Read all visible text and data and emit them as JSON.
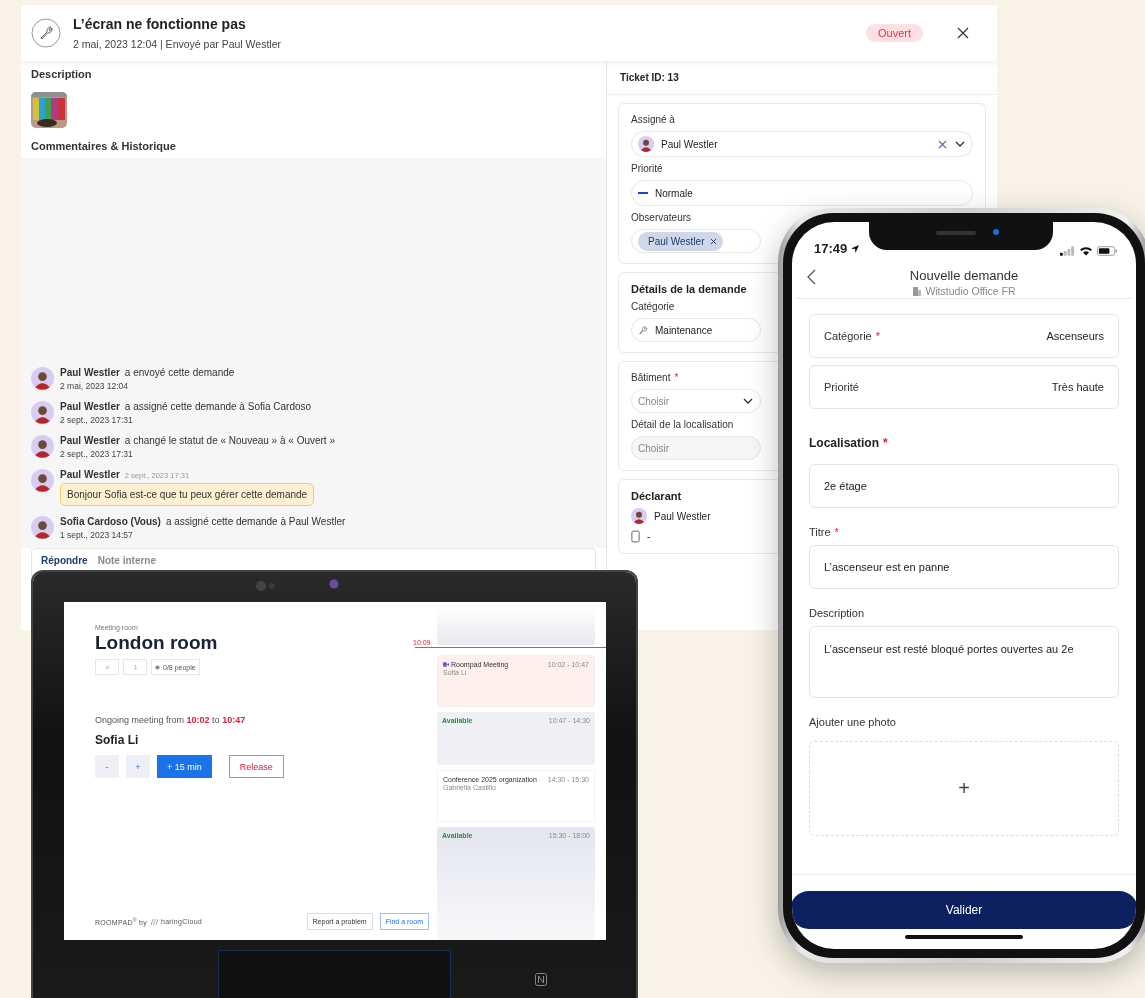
{
  "ticket": {
    "title": "L’écran ne fonctionne pas",
    "meta": "2 mai, 2023 12:04 | Envoyé par Paul Westler",
    "status": "Ouvert",
    "description_label": "Description",
    "comments_label": "Commentaires & Historique",
    "history": [
      {
        "kind": "event",
        "author": "Paul Westler",
        "action": "a envoyé cette demande",
        "time": "2 mai, 2023 12:04"
      },
      {
        "kind": "event",
        "author": "Paul Westler",
        "action": "a assigné cette demande à Sofia Cardoso",
        "time": "2 sept., 2023 17:31"
      },
      {
        "kind": "event",
        "author": "Paul Westler",
        "action": "a changé le statut de « Nouveau » à « Ouvert »",
        "time": "2 sept., 2023 17:31"
      },
      {
        "kind": "comment",
        "author": "Paul Westler",
        "time": "2 sept., 2023 17:31",
        "message": "Bonjour Sofia est-ce que tu peux gérer cette demande"
      },
      {
        "kind": "event",
        "author": "Sofia Cardoso (Vous)",
        "action": "a assigné cette demande à Paul Westler",
        "time": "1 sept., 2023 14:57"
      }
    ],
    "reply_tabs": [
      {
        "label": "Répondre",
        "selected": true
      },
      {
        "label": "Note interne",
        "selected": false
      }
    ],
    "ticket_id": "Ticket ID: 13",
    "assignee_label": "Assigné à",
    "assignee": "Paul Westler",
    "priority_label": "Priorité",
    "priority": "Normale",
    "observers_label": "Observateurs",
    "observers": [
      "Paul Westler"
    ],
    "details_title": "Détails de la demande",
    "category_label": "Catégorie",
    "category": "Maintenance",
    "building_label": "Bâtiment",
    "building_required_mark": "*",
    "building_placeholder": "Choisir",
    "location_label": "Détail de la localisation",
    "location_placeholder": "Choisir",
    "declarant_label": "Déclarant",
    "declarant": "Paul Westler",
    "declarant_phone": "-"
  },
  "tablet": {
    "kicker": "Meeting room",
    "room": "London room",
    "capacity": "0/8 people",
    "ongoing_prefix": "Ongoing meeting from",
    "start": "10:02",
    "joiner": "to",
    "end": "10:47",
    "organizer": "Sofia Li",
    "minus": "-",
    "plus": "+",
    "extend": "+ 15 min",
    "release": "Release",
    "brand": "ROOMPAD$^{®}$ by",
    "brand_company": "haringCloud",
    "report": "Report a problem",
    "find": "Find a room",
    "now": "10:09",
    "schedule": [
      {
        "kind": "past"
      },
      {
        "kind": "meeting",
        "title": "Roompad Meeting",
        "organizer": "Sofia Li",
        "time": "10:02 - 10:47",
        "current": true
      },
      {
        "kind": "available",
        "title": "Available",
        "time": "10:47 - 14:30"
      },
      {
        "kind": "meeting",
        "title": "Conference 2025 organization",
        "organizer": "Gabriella Castillo",
        "time": "14:30 - 15:30",
        "current": false
      },
      {
        "kind": "available",
        "title": "Available",
        "time": "15:30 - 18:00"
      }
    ]
  },
  "phone": {
    "time": "17:49",
    "title": "Nouvelle demande",
    "subtitle": "Witstudio Office FR",
    "form": [
      {
        "kind": "inline",
        "label": "Catégorie",
        "required_mark": "*",
        "value": "Ascenseurs"
      },
      {
        "kind": "inline",
        "label": "Priorité",
        "value": "Très haute"
      },
      {
        "kind": "section",
        "label": "Localisation",
        "required_mark": "*",
        "value": "2e étage"
      },
      {
        "kind": "field",
        "label": "Titre",
        "required_mark": "*",
        "value": "L’ascenseur est en panne"
      },
      {
        "kind": "textarea",
        "label": "Description",
        "value": "L’ascenseur est resté bloqué portes ouvertes au 2e"
      },
      {
        "label": "Ajouter une photo",
        "value": "+"
      }
    ],
    "submit": "Valider"
  }
}
